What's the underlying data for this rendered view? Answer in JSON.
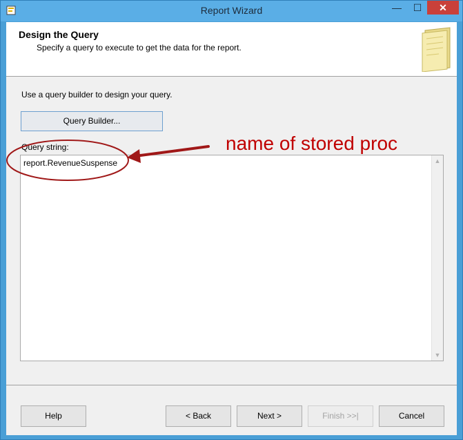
{
  "window": {
    "title": "Report Wizard",
    "controls": {
      "minimize": "—",
      "maximize": "☐",
      "close": "✕"
    }
  },
  "header": {
    "title": "Design the Query",
    "subtitle": "Specify a query to execute to get the data for the report."
  },
  "content": {
    "instruction": "Use a query builder to design your query.",
    "query_builder_label": "Query Builder...",
    "query_string_label": "Query string:",
    "query_string_value": "report.RevenueSuspense"
  },
  "annotation": {
    "text": "name of stored proc",
    "color": "#c00000"
  },
  "footer": {
    "help_label": "Help",
    "back_label": "< Back",
    "next_label": "Next >",
    "finish_label": "Finish >>|",
    "cancel_label": "Cancel"
  },
  "colors": {
    "titlebar": "#5aaee6",
    "close_button": "#c9403a",
    "dialog_body": "#f0f0f0"
  },
  "icons": [
    "app-icon",
    "wizard-page-icon",
    "scroll-up-icon",
    "scroll-down-icon"
  ]
}
